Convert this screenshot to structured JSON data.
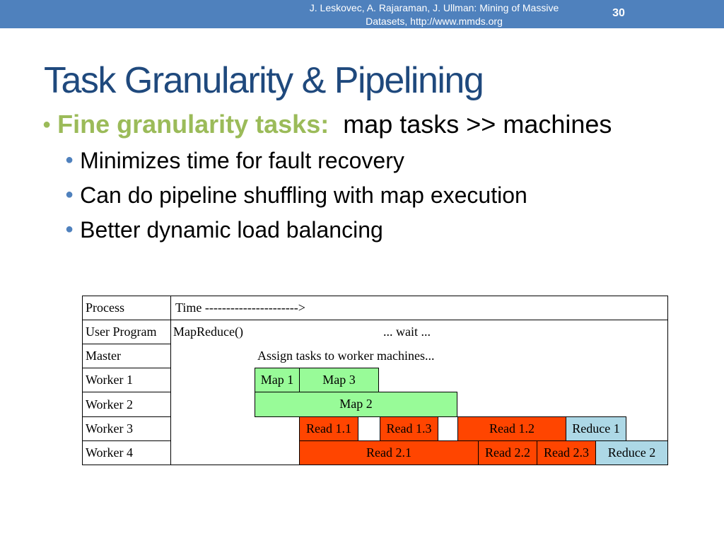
{
  "header": {
    "citation_line1": "J. Leskovec, A. Rajaraman, J. Ullman: Mining of Massive",
    "citation_line2": "Datasets, http://www.mmds.org",
    "slide_number": "30"
  },
  "title": "Task Granularity & Pipelining",
  "bullets": {
    "main_highlight": "Fine granularity tasks:",
    "main_text": "map tasks >> machines",
    "sub": [
      "Minimizes time for fault recovery",
      "Can do pipeline shuffling with map execution",
      "Better dynamic load balancing"
    ]
  },
  "diagram": {
    "header_process": "Process",
    "header_time": "Time ---------------------->",
    "rows": [
      "User Program",
      "Master",
      "Worker 1",
      "Worker 2",
      "Worker 3",
      "Worker 4"
    ],
    "user_program_call": "MapReduce()",
    "user_program_wait": "... wait ...",
    "master_note": "Assign tasks to worker machines...",
    "tasks": {
      "map1": "Map 1",
      "map3": "Map 3",
      "map2": "Map 2",
      "read11": "Read 1.1",
      "read13": "Read 1.3",
      "read12": "Read 1.2",
      "reduce1": "Reduce 1",
      "read21": "Read 2.1",
      "read22": "Read 2.2",
      "read23": "Read 2.3",
      "reduce2": "Reduce 2"
    },
    "colors": {
      "map": "#98fb98",
      "read": "#ff4500",
      "reduce": "#add8e6"
    }
  }
}
